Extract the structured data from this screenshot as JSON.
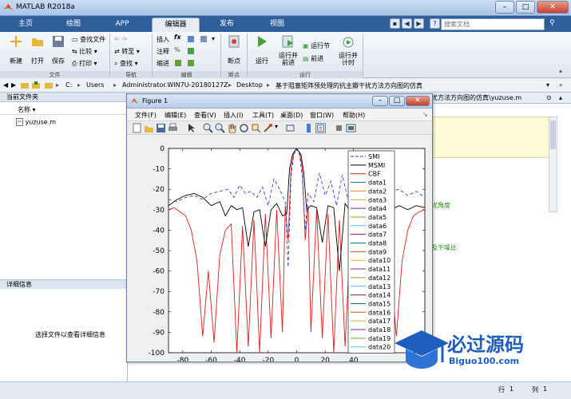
{
  "window": {
    "title": "MATLAB R2018a",
    "minimize": "–",
    "maximize": "□",
    "close": "✕"
  },
  "tabs": [
    "主页",
    "绘图",
    "APP",
    "编辑器",
    "发布",
    "视图"
  ],
  "search": {
    "placeholder": "搜索文档"
  },
  "quick_access": [
    "?",
    "◀",
    "▶"
  ],
  "ribbon": {
    "file": {
      "new": "新建",
      "open": "打开",
      "save": "保存",
      "find_files": "查找文件",
      "compare": "比较",
      "print": "打印",
      "group": "文件"
    },
    "navigate": {
      "goto": "转至",
      "find": "查找",
      "group": "导航"
    },
    "edit": {
      "insert": "插入",
      "comment": "注释",
      "indent": "缩进",
      "group": "编辑"
    },
    "breakpoints": {
      "label": "断点",
      "group": "断点"
    },
    "run": {
      "run": "运行",
      "run_advance": "运行并\n前进",
      "run_section": "运行节",
      "advance": "前进",
      "run_time": "运行并\n计时",
      "group": "运行"
    },
    "icons": {
      "fx": "fx",
      "percent": "%"
    }
  },
  "address": {
    "segments": [
      "C:",
      "Users",
      "Administrator.WIN7U-20180127Z",
      "Desktop",
      "基于阻塞矩阵预处理的抗主瓣干扰方法方向图的仿真"
    ],
    "separator": "▸"
  },
  "current_folder": {
    "title": "当前文件夹",
    "column": "名称",
    "files": [
      "yuzuse.m"
    ]
  },
  "details": {
    "title": "详细信息",
    "hint": "选择文件以查看详细信息"
  },
  "editor": {
    "tab_text": "扰方法方向图的仿真\\yuzuse.m",
    "side_texts": [
      "扰角度",
      "及干噪比"
    ]
  },
  "figure": {
    "title": "Figure 1",
    "menus": [
      "文件(F)",
      "编辑(E)",
      "查看(V)",
      "插入(I)",
      "工具(T)",
      "桌面(D)",
      "窗口(W)",
      "帮助(H)"
    ],
    "win_minimize": "–",
    "win_maximize": "□",
    "win_close": "✕"
  },
  "status": {
    "row_label": "行",
    "row_value": "1",
    "col_label": "列",
    "col_value": "1"
  },
  "watermark": {
    "title": "必过源码",
    "url": "Biguo100.com"
  },
  "chart_data": {
    "type": "line",
    "xlim": [
      -90,
      90
    ],
    "ylim": [
      -100,
      0
    ],
    "xticks": [
      -80,
      -60,
      -40,
      -20,
      0,
      20,
      40
    ],
    "yticks": [
      0,
      -10,
      -20,
      -30,
      -40,
      -50,
      -60,
      -70,
      -80,
      -90,
      -100
    ],
    "grid": false,
    "legend_position": "top-right",
    "legend": [
      "SMI",
      "MSMI",
      "CBF",
      "data1",
      "data2",
      "data3",
      "data4",
      "data5",
      "data6",
      "data7",
      "data8",
      "data9",
      "data10",
      "data11",
      "data12",
      "data13",
      "data14",
      "data15",
      "data16",
      "data17",
      "data18",
      "data19",
      "data20"
    ],
    "legend_colors": [
      "#2a3ee0",
      "#000000",
      "#e31a1c",
      "#1f77b4",
      "#ff7f0e",
      "#bcbd22",
      "#7e2f8e",
      "#77ac30",
      "#4dbeee",
      "#a2142f",
      "#0072bd",
      "#d95319",
      "#edb120",
      "#7e2f8e",
      "#77ac30",
      "#4dbeee",
      "#a2142f",
      "#0072bd",
      "#d95319",
      "#edb120",
      "#7e2f8e",
      "#77ac30",
      "#4dbeee"
    ],
    "series": [
      {
        "name": "SMI",
        "style": "dashed",
        "color": "#2a3ee0",
        "x": [
          -90,
          -84,
          -78,
          -72,
          -66,
          -60,
          -54,
          -48,
          -44,
          -40,
          -36,
          -32,
          -28,
          -24,
          -20,
          -16,
          -12,
          -8,
          -6,
          -4,
          -2,
          0,
          2,
          4,
          6,
          8,
          12,
          16,
          20,
          24,
          28,
          32,
          36,
          40,
          44,
          48,
          54,
          60,
          66,
          72,
          78,
          84,
          90
        ],
        "y": [
          -25,
          -26,
          -24,
          -23,
          -25,
          -22,
          -21,
          -20,
          -24,
          -18,
          -22,
          -21,
          -24,
          -19,
          -28,
          -15,
          -20,
          -26,
          -58,
          -14,
          -3,
          0,
          -3,
          -14,
          -40,
          -22,
          -26,
          -12,
          -23,
          -16,
          -28,
          -13,
          -25,
          -14,
          -20,
          -17,
          -22,
          -19,
          -21,
          -20,
          -23,
          -21,
          -24
        ]
      },
      {
        "name": "MSMI",
        "style": "solid",
        "color": "#000000",
        "x": [
          -90,
          -84,
          -78,
          -72,
          -66,
          -60,
          -54,
          -50,
          -46,
          -42,
          -38,
          -34,
          -30,
          -26,
          -22,
          -18,
          -14,
          -10,
          -7,
          -5,
          -3,
          -1,
          0,
          1,
          3,
          5,
          7,
          10,
          14,
          18,
          22,
          26,
          30,
          34,
          38,
          42,
          46,
          50,
          54,
          60,
          66,
          72,
          78,
          84,
          90
        ],
        "y": [
          -28,
          -25,
          -23,
          -22,
          -24,
          -28,
          -26,
          -33,
          -28,
          -30,
          -29,
          -48,
          -31,
          -30,
          -48,
          -30,
          -27,
          -33,
          -32,
          -10,
          -3,
          -1,
          0,
          -1,
          -3,
          -12,
          -30,
          -28,
          -29,
          -46,
          -28,
          -29,
          -60,
          -27,
          -31,
          -26,
          -30,
          -28,
          -32,
          -26,
          -30,
          -28,
          -30,
          -28,
          -29
        ]
      },
      {
        "name": "CBF",
        "style": "solid",
        "color": "#e31a1c",
        "x": [
          -90,
          -86,
          -82,
          -78,
          -74,
          -70,
          -66,
          -62,
          -58,
          -54,
          -50,
          -46,
          -42,
          -38,
          -34,
          -30,
          -26,
          -22,
          -18,
          -14,
          -10,
          -8,
          -6,
          -4,
          -2,
          0,
          2,
          4,
          6,
          8,
          10,
          14,
          18,
          22,
          26,
          30,
          34,
          38,
          42,
          46,
          50,
          54,
          58,
          62,
          66,
          70,
          74,
          78,
          82,
          86,
          90
        ],
        "y": [
          -30,
          -29,
          -31,
          -33,
          -40,
          -55,
          -92,
          -60,
          -95,
          -52,
          -40,
          -37,
          -100,
          -38,
          -97,
          -35,
          -100,
          -32,
          -93,
          -30,
          -90,
          -28,
          -45,
          -10,
          -2,
          0,
          -2,
          -10,
          -45,
          -28,
          -90,
          -30,
          -93,
          -32,
          -100,
          -35,
          -97,
          -38,
          -100,
          -37,
          -96,
          -40,
          -52,
          -95,
          -60,
          -92,
          -55,
          -40,
          -33,
          -31,
          -30
        ]
      }
    ]
  }
}
